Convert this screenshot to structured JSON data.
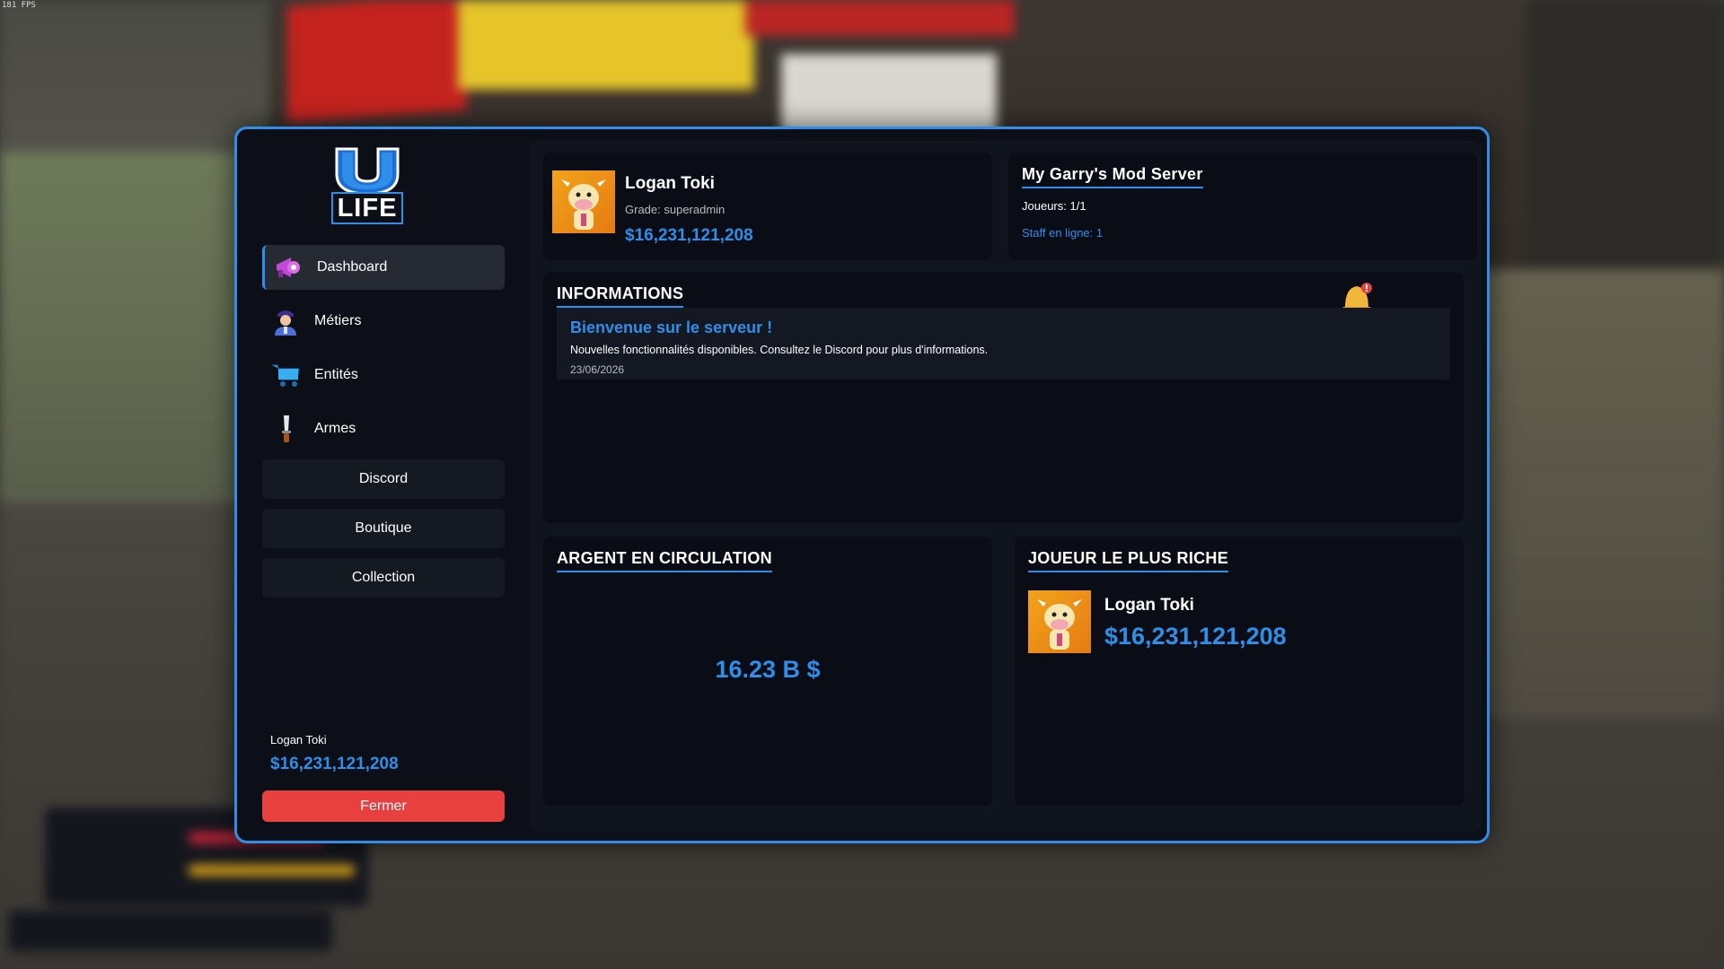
{
  "hud": {
    "fps": "181 FPS"
  },
  "logo": {
    "letter": "U",
    "text": "LIFE"
  },
  "nav": [
    {
      "label": "Dashboard",
      "icon": "megaphone-icon"
    },
    {
      "label": "Métiers",
      "icon": "worker-icon"
    },
    {
      "label": "Entités",
      "icon": "cart-icon"
    },
    {
      "label": "Armes",
      "icon": "knife-icon"
    }
  ],
  "links": [
    {
      "label": "Discord"
    },
    {
      "label": "Boutique"
    },
    {
      "label": "Collection"
    }
  ],
  "sidebar_user": {
    "name": "Logan Toki",
    "money": "$16,231,121,208"
  },
  "close_label": "Fermer",
  "profile": {
    "name": "Logan Toki",
    "grade": "Grade: superadmin",
    "money": "$16,231,121,208"
  },
  "server": {
    "name": "My Garry's Mod Server",
    "players": "Joueurs: 1/1",
    "staff": "Staff en ligne: 1"
  },
  "informations": {
    "title": "INFORMATIONS",
    "post_title": "Bienvenue sur le serveur !",
    "post_body": "Nouvelles fonctionnalités disponibles. Consultez le Discord pour plus d'informations.",
    "post_date": "23/06/2026"
  },
  "circulation": {
    "title": "ARGENT EN CIRCULATION",
    "value": "16.23 B $"
  },
  "richest": {
    "title": "JOUEUR LE PLUS RICHE",
    "name": "Logan Toki",
    "money": "$16,231,121,208"
  },
  "colors": {
    "accent": "#2f8ee8",
    "danger": "#e8403f",
    "panel": "#0c0f17"
  }
}
